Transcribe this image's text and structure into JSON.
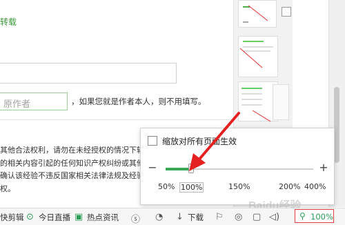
{
  "article": {
    "repost_label": "转载",
    "author_placeholder": "原作者",
    "author_hint": "，如果您就是作者本人，则不用填写。",
    "legal_lines": [
      "其他合法权利，请勿在未经授权的情况下转",
      "的相关内容引起的任何知识产权纠纷或其他",
      "确认该经验不违反国家相关法律法规及经验",
      "权。"
    ]
  },
  "zoom_popup": {
    "checkbox_label": "缩放对所有页面生效",
    "minus": "−",
    "plus": "+",
    "ticks": [
      "50%",
      "100%",
      "150%",
      "200%",
      "400%"
    ],
    "current": "100%"
  },
  "statusbar": {
    "items": [
      "快剪辑",
      "今日直播",
      "热点资讯",
      "下载"
    ],
    "zoom_value": "100%"
  },
  "watermark": "Baidu经验",
  "colors": {
    "accent_green": "#3aa655",
    "highlight_red": "#e04040"
  },
  "icons": [
    "play-circle-icon",
    "news-icon",
    "download-arrow-icon",
    "speaker-icon",
    "search-zoom-icon"
  ]
}
